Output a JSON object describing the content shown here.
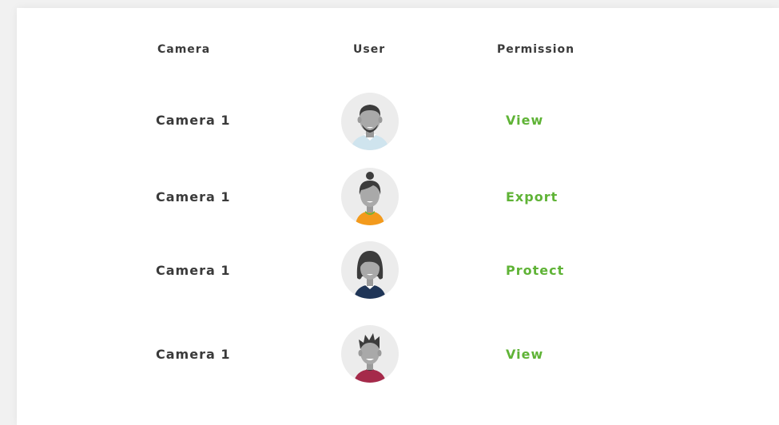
{
  "table": {
    "headers": {
      "camera": "Camera",
      "user": "User",
      "permission": "Permission"
    },
    "rows": [
      {
        "camera": "Camera 1",
        "avatar": "male-user-avatar",
        "permission": "View"
      },
      {
        "camera": "Camera 1",
        "avatar": "female-user-bun-avatar",
        "permission": "Export"
      },
      {
        "camera": "Camera 1",
        "avatar": "female-user-bob-avatar",
        "permission": "Protect"
      },
      {
        "camera": "Camera 1",
        "avatar": "male-user-spiky-hair-avatar",
        "permission": "View"
      }
    ]
  },
  "colors": {
    "permission_text": "#5fb336",
    "label_text": "#3a3a3a",
    "avatar_bg": "#ececec",
    "shirt_light_blue": "#cfe4ee",
    "shirt_orange": "#f39a1c",
    "shirt_navy": "#1f3557",
    "shirt_crimson": "#a52a4a"
  }
}
